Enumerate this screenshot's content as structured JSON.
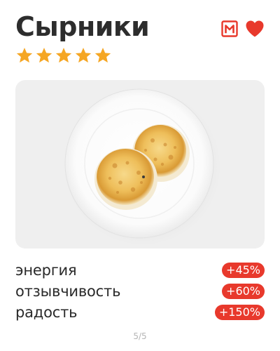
{
  "title": "Сырники",
  "rating": {
    "value": 5,
    "max": 5,
    "star_color": "#f5a623"
  },
  "header": {
    "brand_icon": "magnit-logo-icon",
    "brand_letter": "М",
    "brand_color": "#e8392c",
    "favorite_icon": "heart-icon",
    "favorite_color": "#e8392c"
  },
  "image": {
    "subject": "photo of syrniki on a white plate"
  },
  "stats": [
    {
      "label": "энергия",
      "value": "+45%"
    },
    {
      "label": "отзывчивость",
      "value": "+60%"
    },
    {
      "label": "радость",
      "value": "+150%"
    }
  ],
  "badge_color": "#e8392c",
  "pager": {
    "current": 5,
    "total": 5,
    "text": "5/5"
  }
}
